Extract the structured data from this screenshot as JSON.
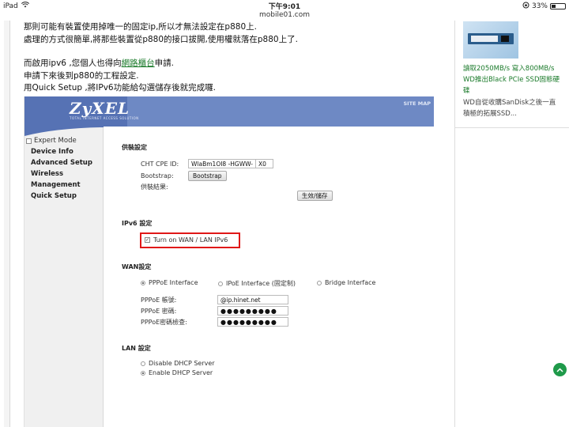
{
  "status_bar": {
    "device": "iPad",
    "time": "下午9:01",
    "battery": "33%",
    "battery_level": 0.33
  },
  "url": "mobile01.com",
  "article": {
    "line1": "那則可能有裝置使用掉唯一的固定ip,所以才無法設定在p880上.",
    "line2": "處理的方式很簡單,將那些裝置從p880的接口拔開,使用權就落在p880上了.",
    "line3_before": "而啟用ipv6 ,您個人也得向",
    "line3_link": "網路櫃台",
    "line3_after": "申請.",
    "line4": "申請下來後到p880的工程設定.",
    "line5": "用Quick Setup ,將IPv6功能給勾選儲存後就完成囉."
  },
  "router": {
    "logo": "ZyXEL",
    "tagline": "TOTAL INTERNET ACCESS SOLUTION",
    "sitemap": "SITE MAP",
    "nav": {
      "expert_mode": "Expert Mode",
      "items": [
        "Device Info",
        "Advanced Setup",
        "Wireless",
        "Management",
        "Quick Setup"
      ]
    },
    "provision": {
      "title": "供裝設定",
      "cpe_label": "CHT CPE ID:",
      "cpe_value": "WlaBm1OI8 -HGWW-",
      "cpe_suffix": "X0",
      "bootstrap_label": "Bootstrap:",
      "bootstrap_button": "Bootstrap",
      "result_label": "供裝結果:",
      "apply_button": "生效/儲存"
    },
    "ipv6": {
      "title": "IPv6 設定",
      "checkbox_label": "Turn on WAN / LAN IPv6"
    },
    "wan": {
      "title": "WAN設定",
      "options": [
        "PPPoE Interface",
        "IPoE Interface (固定制)",
        "Bridge Interface"
      ],
      "pppoe_account_label": "PPPoE 帳號:",
      "pppoe_account_value": "@ip.hinet.net",
      "pppoe_password_label": "PPPoE 密碼:",
      "pppoe_password_value": "●●●●●●●●●",
      "pppoe_confirm_label": "PPPoE密碼檢查:",
      "pppoe_confirm_value": "●●●●●●●●●"
    },
    "lan": {
      "title": "LAN 設定",
      "options": [
        "Disable DHCP Server",
        "Enable DHCP Server"
      ]
    }
  },
  "sidebar": {
    "title": "讀取2050MB/s 寫入800MB/s WD推出Black PCIe SSD固態硬碟",
    "desc": "WD自從收購SanDisk之後一直積極的拓展SSD..."
  },
  "icons": {
    "wifi": "wifi-icon",
    "scroll_top": "chevron-up-icon"
  },
  "colors": {
    "link_green": "#1a7a2a",
    "zyxel_blue": "#6e89c4",
    "highlight_red": "#e01818",
    "scroll_button": "#1f9a4a"
  }
}
